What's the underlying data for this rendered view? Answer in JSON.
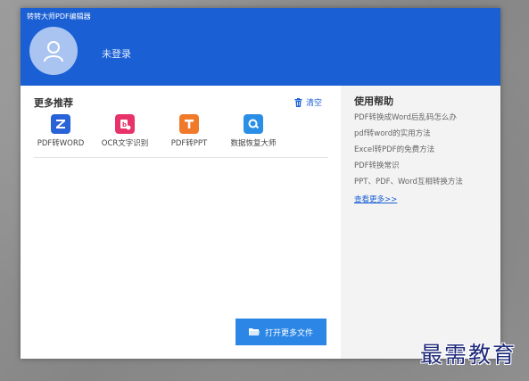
{
  "app": {
    "title": "转转大师PDF编辑器"
  },
  "user": {
    "status": "未登录",
    "avatar_icon": "user-icon"
  },
  "recommend": {
    "title": "更多推荐",
    "clear_label": "清空",
    "clear_icon": "trash-icon",
    "tools": [
      {
        "label": "PDF转WORD",
        "icon": "pdf-to-word-icon",
        "color": "#2a63d8"
      },
      {
        "label": "OCR文字识别",
        "icon": "ocr-icon",
        "color": "#e8336a"
      },
      {
        "label": "PDF转PPT",
        "icon": "pdf-to-ppt-icon",
        "color": "#f07a2a"
      },
      {
        "label": "数据恢复大师",
        "icon": "data-recovery-icon",
        "color": "#2a8ee6"
      }
    ]
  },
  "open_more": {
    "label": "打开更多文件",
    "icon": "folder-icon"
  },
  "help": {
    "title": "使用帮助",
    "items": [
      "PDF转换成Word后乱码怎么办",
      "pdf转word的实用方法",
      "Excel转PDF的免费方法",
      "PDF转换常识",
      "PPT、PDF、Word互相转换方法"
    ],
    "more_label": "查看更多>>"
  },
  "watermark": "最需教育",
  "colors": {
    "header": "#1a5fd4",
    "accent": "#2b86e6",
    "link": "#1a5fd4",
    "help_bg": "#f3f3f3"
  }
}
